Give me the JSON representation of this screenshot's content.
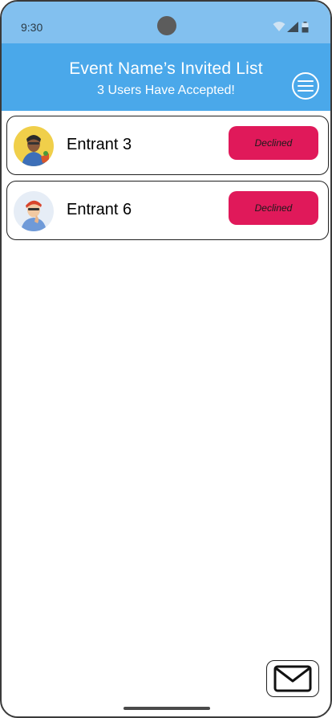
{
  "status_bar": {
    "time": "9:30"
  },
  "header": {
    "title": "Event Name’s Invited List",
    "subtitle": "3 Users Have Accepted!"
  },
  "entrants": [
    {
      "name": "Entrant 3",
      "status": "Declined",
      "avatar": "avatar-person-yellow-bg"
    },
    {
      "name": "Entrant 6",
      "status": "Declined",
      "avatar": "avatar-person-red-hair"
    }
  ],
  "icons": {
    "menu": "hamburger-menu-icon",
    "mail": "envelope-icon",
    "wifi": "wifi-icon",
    "signal": "signal-icon",
    "battery": "battery-icon"
  },
  "colors": {
    "status_bar": "#82c0ef",
    "header": "#4aa8ea",
    "declined_badge": "#e0195a"
  }
}
